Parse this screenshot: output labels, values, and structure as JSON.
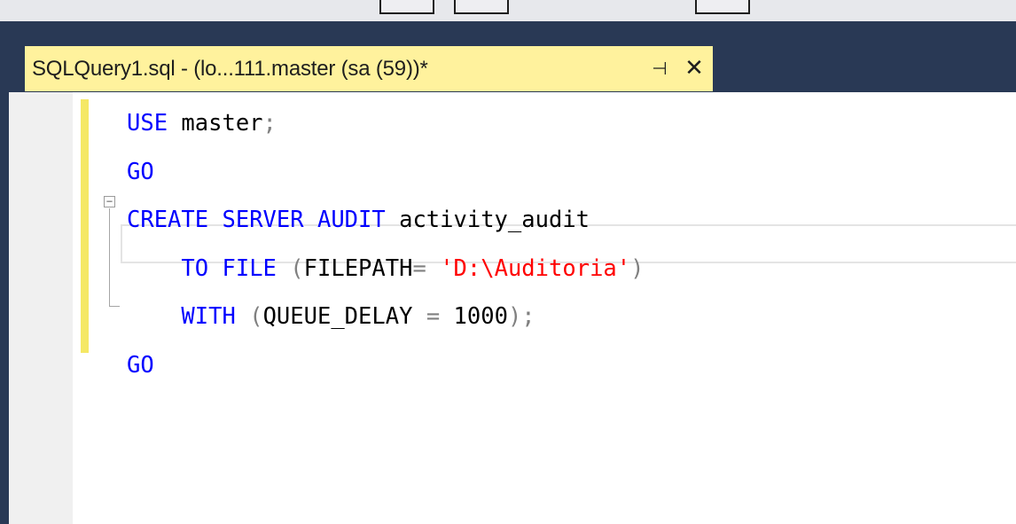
{
  "tab": {
    "title": "SQLQuery1.sql - (lo...111.master (sa (59))*",
    "pin_glyph": "⊣",
    "close_glyph": "✕"
  },
  "editor": {
    "lines": [
      [
        {
          "t": "USE",
          "c": "kw"
        },
        {
          "t": " master",
          "c": "txt"
        },
        {
          "t": ";",
          "c": "gray"
        }
      ],
      [
        {
          "t": "GO",
          "c": "kw"
        }
      ],
      [
        {
          "t": "CREATE",
          "c": "kw"
        },
        {
          "t": " ",
          "c": "txt"
        },
        {
          "t": "SERVER",
          "c": "kw"
        },
        {
          "t": " ",
          "c": "txt"
        },
        {
          "t": "AUDIT",
          "c": "kw"
        },
        {
          "t": " activity_audit",
          "c": "txt"
        }
      ],
      [
        {
          "t": "    ",
          "c": "txt"
        },
        {
          "t": "TO",
          "c": "kw"
        },
        {
          "t": " ",
          "c": "txt"
        },
        {
          "t": "FILE",
          "c": "kw"
        },
        {
          "t": " ",
          "c": "txt"
        },
        {
          "t": "(",
          "c": "gray"
        },
        {
          "t": "FILEPATH",
          "c": "txt"
        },
        {
          "t": "=",
          "c": "gray"
        },
        {
          "t": " ",
          "c": "txt"
        },
        {
          "t": "'D:\\Auditoria'",
          "c": "str"
        },
        {
          "t": ")",
          "c": "gray"
        }
      ],
      [
        {
          "t": "    ",
          "c": "txt"
        },
        {
          "t": "WITH",
          "c": "kw"
        },
        {
          "t": " ",
          "c": "txt"
        },
        {
          "t": "(",
          "c": "gray"
        },
        {
          "t": "QUEUE_DELAY",
          "c": "txt"
        },
        {
          "t": " ",
          "c": "txt"
        },
        {
          "t": "=",
          "c": "gray"
        },
        {
          "t": " 1000",
          "c": "txt"
        },
        {
          "t": ");",
          "c": "gray"
        }
      ],
      [
        {
          "t": "GO",
          "c": "kw"
        }
      ]
    ],
    "fold_glyph": "−"
  },
  "colors": {
    "keyword": "#0000ff",
    "operator": "#808080",
    "string": "#ff0000",
    "tab_active": "#fff29d",
    "frame": "#293955",
    "change_bar": "#f5e865"
  }
}
